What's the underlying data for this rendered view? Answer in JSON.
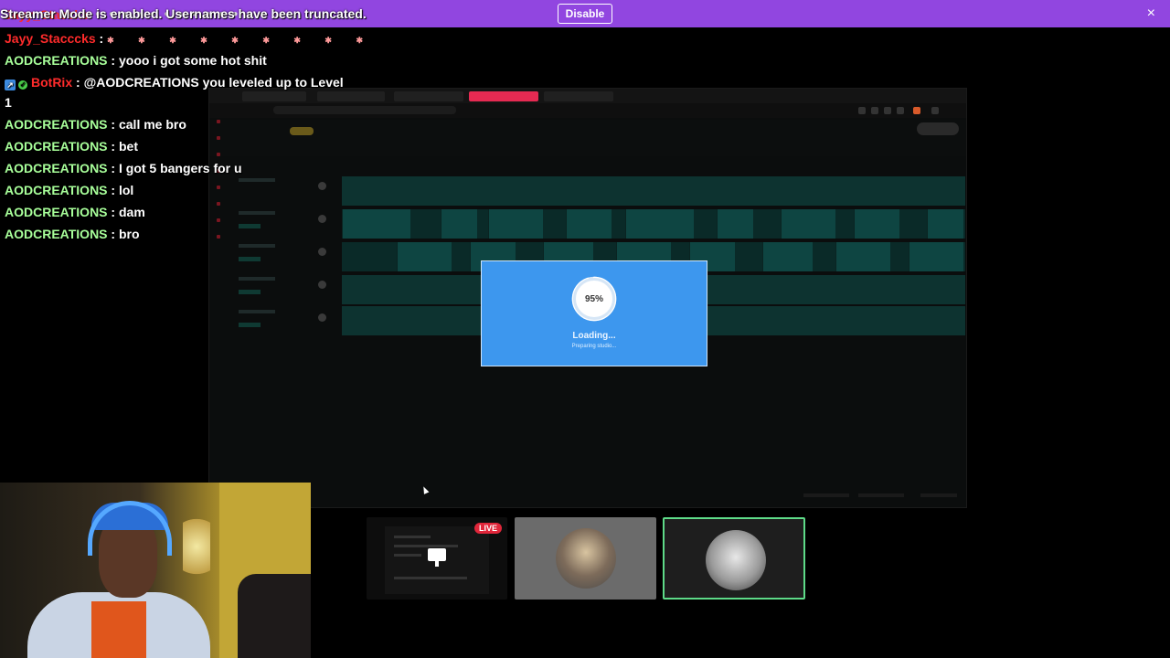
{
  "banner": {
    "message": "Streamer Mode is enabled. Usernames have been truncated.",
    "disable_label": "Disable",
    "close_icon": "×",
    "ghost_user": "Jayy_Staccks",
    "ghost_emotes": "●●●●●●●●●●●●●"
  },
  "chat": {
    "messages": [
      {
        "user": "Jayy_Stacccks",
        "sep": " : ",
        "text": "✱ ✱ ✱ ✱ ✱ ✱ ✱ ✱ ✱"
      },
      {
        "user": "AODCREATIONS",
        "sep": " : ",
        "text": "yooo i got some hot shit"
      },
      {
        "user": "BotRix",
        "sep": " : ",
        "text": "@AODCREATIONS you leveled up to Level",
        "continuation": "1"
      },
      {
        "user": "AODCREATIONS",
        "sep": " : ",
        "text": "call me bro"
      },
      {
        "user": "AODCREATIONS",
        "sep": " : ",
        "text": "bet"
      },
      {
        "user": "AODCREATIONS",
        "sep": " : ",
        "text": "I got 5 bangers for u"
      },
      {
        "user": "AODCREATIONS",
        "sep": " : ",
        "text": "lol"
      },
      {
        "user": "AODCREATIONS",
        "sep": " : ",
        "text": "dam"
      },
      {
        "user": "AODCREATIONS",
        "sep": " : ",
        "text": "bro"
      }
    ]
  },
  "loading": {
    "percent": "95%",
    "progress": 0.95,
    "title": "Loading...",
    "subtitle": "Preparing studio..."
  },
  "tiles": {
    "live_label": "LIVE"
  },
  "colors": {
    "banner": "#9146e0",
    "loading_bg": "#3d97ee",
    "selected_tile_border": "#5edb88",
    "live_badge": "#e0263a"
  },
  "icons": {
    "close": "close-icon",
    "monitor": "monitor-icon",
    "checkmark_badge": "check-badge-icon",
    "bot_badge": "bot-badge-icon",
    "cursor": "mouse-cursor-icon"
  }
}
